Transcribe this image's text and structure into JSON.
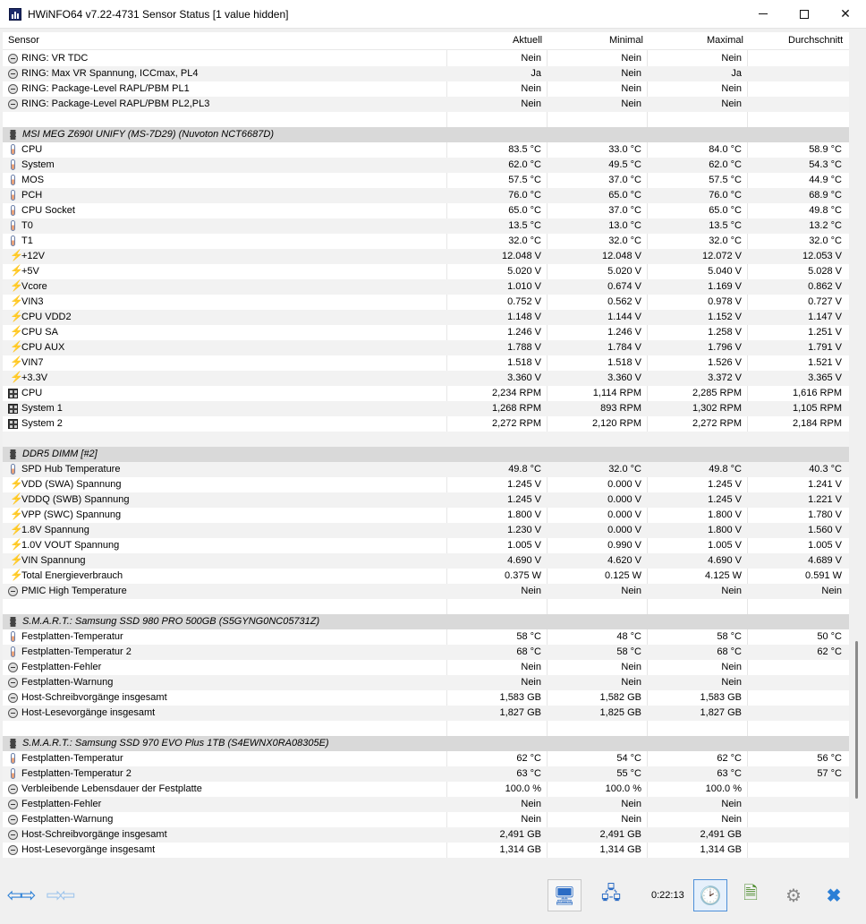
{
  "window": {
    "title": "HWiNFO64 v7.22-4731 Sensor Status [1 value hidden]"
  },
  "columns": {
    "sensor": "Sensor",
    "current": "Aktuell",
    "min": "Minimal",
    "max": "Maximal",
    "avg": "Durchschnitt"
  },
  "rows": [
    {
      "kind": "item",
      "icon": "status",
      "name": "RING: VR TDC",
      "v": [
        "Nein",
        "Nein",
        "Nein",
        ""
      ]
    },
    {
      "kind": "item",
      "icon": "status",
      "name": "RING: Max VR Spannung, ICCmax, PL4",
      "v": [
        "Ja",
        "Nein",
        "Ja",
        ""
      ]
    },
    {
      "kind": "item",
      "icon": "status",
      "name": "RING: Package-Level RAPL/PBM PL1",
      "v": [
        "Nein",
        "Nein",
        "Nein",
        ""
      ]
    },
    {
      "kind": "item",
      "icon": "status",
      "name": "RING: Package-Level RAPL/PBM PL2,PL3",
      "v": [
        "Nein",
        "Nein",
        "Nein",
        ""
      ]
    },
    {
      "kind": "blank"
    },
    {
      "kind": "group",
      "icon": "chip",
      "name": "MSI MEG Z690I UNIFY (MS-7D29) (Nuvoton NCT6687D)"
    },
    {
      "kind": "item",
      "icon": "thermo",
      "name": "CPU",
      "v": [
        "83.5 °C",
        "33.0 °C",
        "84.0 °C",
        "58.9 °C"
      ]
    },
    {
      "kind": "item",
      "icon": "thermo",
      "name": "System",
      "v": [
        "62.0 °C",
        "49.5 °C",
        "62.0 °C",
        "54.3 °C"
      ]
    },
    {
      "kind": "item",
      "icon": "thermo",
      "name": "MOS",
      "v": [
        "57.5 °C",
        "37.0 °C",
        "57.5 °C",
        "44.9 °C"
      ]
    },
    {
      "kind": "item",
      "icon": "thermo",
      "name": "PCH",
      "v": [
        "76.0 °C",
        "65.0 °C",
        "76.0 °C",
        "68.9 °C"
      ]
    },
    {
      "kind": "item",
      "icon": "thermo",
      "name": "CPU Socket",
      "v": [
        "65.0 °C",
        "37.0 °C",
        "65.0 °C",
        "49.8 °C"
      ]
    },
    {
      "kind": "item",
      "icon": "thermo",
      "name": "T0",
      "v": [
        "13.5 °C",
        "13.0 °C",
        "13.5 °C",
        "13.2 °C"
      ]
    },
    {
      "kind": "item",
      "icon": "thermo",
      "name": "T1",
      "v": [
        "32.0 °C",
        "32.0 °C",
        "32.0 °C",
        "32.0 °C"
      ]
    },
    {
      "kind": "item",
      "icon": "volt",
      "name": "+12V",
      "v": [
        "12.048 V",
        "12.048 V",
        "12.072 V",
        "12.053 V"
      ]
    },
    {
      "kind": "item",
      "icon": "volt",
      "name": "+5V",
      "v": [
        "5.020 V",
        "5.020 V",
        "5.040 V",
        "5.028 V"
      ]
    },
    {
      "kind": "item",
      "icon": "volt",
      "name": "Vcore",
      "v": [
        "1.010 V",
        "0.674 V",
        "1.169 V",
        "0.862 V"
      ]
    },
    {
      "kind": "item",
      "icon": "volt",
      "name": "VIN3",
      "v": [
        "0.752 V",
        "0.562 V",
        "0.978 V",
        "0.727 V"
      ]
    },
    {
      "kind": "item",
      "icon": "volt",
      "name": "CPU VDD2",
      "v": [
        "1.148 V",
        "1.144 V",
        "1.152 V",
        "1.147 V"
      ]
    },
    {
      "kind": "item",
      "icon": "volt",
      "name": "CPU SA",
      "v": [
        "1.246 V",
        "1.246 V",
        "1.258 V",
        "1.251 V"
      ]
    },
    {
      "kind": "item",
      "icon": "volt",
      "name": "CPU AUX",
      "v": [
        "1.788 V",
        "1.784 V",
        "1.796 V",
        "1.791 V"
      ]
    },
    {
      "kind": "item",
      "icon": "volt",
      "name": "VIN7",
      "v": [
        "1.518 V",
        "1.518 V",
        "1.526 V",
        "1.521 V"
      ]
    },
    {
      "kind": "item",
      "icon": "volt",
      "name": "+3.3V",
      "v": [
        "3.360 V",
        "3.360 V",
        "3.372 V",
        "3.365 V"
      ]
    },
    {
      "kind": "item",
      "icon": "fan",
      "name": "CPU",
      "v": [
        "2,234 RPM",
        "1,114 RPM",
        "2,285 RPM",
        "1,616 RPM"
      ]
    },
    {
      "kind": "item",
      "icon": "fan",
      "name": "System 1",
      "v": [
        "1,268 RPM",
        "893 RPM",
        "1,302 RPM",
        "1,105 RPM"
      ]
    },
    {
      "kind": "item",
      "icon": "fan",
      "name": "System 2",
      "v": [
        "2,272 RPM",
        "2,120 RPM",
        "2,272 RPM",
        "2,184 RPM"
      ]
    },
    {
      "kind": "blank"
    },
    {
      "kind": "group",
      "icon": "chip",
      "name": "DDR5 DIMM [#2]"
    },
    {
      "kind": "item",
      "icon": "thermo",
      "name": "SPD Hub Temperature",
      "v": [
        "49.8 °C",
        "32.0 °C",
        "49.8 °C",
        "40.3 °C"
      ]
    },
    {
      "kind": "item",
      "icon": "volt",
      "name": "VDD (SWA) Spannung",
      "v": [
        "1.245 V",
        "0.000 V",
        "1.245 V",
        "1.241 V"
      ]
    },
    {
      "kind": "item",
      "icon": "volt",
      "name": "VDDQ (SWB) Spannung",
      "v": [
        "1.245 V",
        "0.000 V",
        "1.245 V",
        "1.221 V"
      ]
    },
    {
      "kind": "item",
      "icon": "volt",
      "name": "VPP (SWC) Spannung",
      "v": [
        "1.800 V",
        "0.000 V",
        "1.800 V",
        "1.780 V"
      ]
    },
    {
      "kind": "item",
      "icon": "volt",
      "name": "1.8V Spannung",
      "v": [
        "1.230 V",
        "0.000 V",
        "1.800 V",
        "1.560 V"
      ]
    },
    {
      "kind": "item",
      "icon": "volt",
      "name": "1.0V VOUT Spannung",
      "v": [
        "1.005 V",
        "0.990 V",
        "1.005 V",
        "1.005 V"
      ]
    },
    {
      "kind": "item",
      "icon": "volt",
      "name": "VIN Spannung",
      "v": [
        "4.690 V",
        "4.620 V",
        "4.690 V",
        "4.689 V"
      ]
    },
    {
      "kind": "item",
      "icon": "volt",
      "name": "Total Energieverbrauch",
      "v": [
        "0.375 W",
        "0.125 W",
        "4.125 W",
        "0.591 W"
      ]
    },
    {
      "kind": "item",
      "icon": "status",
      "name": "PMIC High Temperature",
      "v": [
        "Nein",
        "Nein",
        "Nein",
        "Nein"
      ]
    },
    {
      "kind": "blank"
    },
    {
      "kind": "group",
      "icon": "chip",
      "name": "S.M.A.R.T.: Samsung SSD 980 PRO 500GB (S5GYNG0NC05731Z)"
    },
    {
      "kind": "item",
      "icon": "thermo",
      "name": "Festplatten-Temperatur",
      "v": [
        "58 °C",
        "48 °C",
        "58 °C",
        "50 °C"
      ]
    },
    {
      "kind": "item",
      "icon": "thermo",
      "name": "Festplatten-Temperatur 2",
      "v": [
        "68 °C",
        "58 °C",
        "68 °C",
        "62 °C"
      ]
    },
    {
      "kind": "item",
      "icon": "status",
      "name": "Festplatten-Fehler",
      "v": [
        "Nein",
        "Nein",
        "Nein",
        ""
      ]
    },
    {
      "kind": "item",
      "icon": "status",
      "name": "Festplatten-Warnung",
      "v": [
        "Nein",
        "Nein",
        "Nein",
        ""
      ]
    },
    {
      "kind": "item",
      "icon": "status",
      "name": "Host-Schreibvorgänge insgesamt",
      "v": [
        "1,583 GB",
        "1,582 GB",
        "1,583 GB",
        ""
      ]
    },
    {
      "kind": "item",
      "icon": "status",
      "name": "Host-Lesevorgänge insgesamt",
      "v": [
        "1,827 GB",
        "1,825 GB",
        "1,827 GB",
        ""
      ]
    },
    {
      "kind": "blank"
    },
    {
      "kind": "group",
      "icon": "chip",
      "name": "S.M.A.R.T.: Samsung SSD 970 EVO Plus 1TB (S4EWNX0RA08305E)"
    },
    {
      "kind": "item",
      "icon": "thermo",
      "name": "Festplatten-Temperatur",
      "v": [
        "62 °C",
        "54 °C",
        "62 °C",
        "56 °C"
      ]
    },
    {
      "kind": "item",
      "icon": "thermo",
      "name": "Festplatten-Temperatur 2",
      "v": [
        "63 °C",
        "55 °C",
        "63 °C",
        "57 °C"
      ]
    },
    {
      "kind": "item",
      "icon": "status",
      "name": "Verbleibende Lebensdauer der Festplatte",
      "v": [
        "100.0 %",
        "100.0 %",
        "100.0 %",
        ""
      ]
    },
    {
      "kind": "item",
      "icon": "status",
      "name": "Festplatten-Fehler",
      "v": [
        "Nein",
        "Nein",
        "Nein",
        ""
      ]
    },
    {
      "kind": "item",
      "icon": "status",
      "name": "Festplatten-Warnung",
      "v": [
        "Nein",
        "Nein",
        "Nein",
        ""
      ]
    },
    {
      "kind": "item",
      "icon": "status",
      "name": "Host-Schreibvorgänge insgesamt",
      "v": [
        "2,491 GB",
        "2,491 GB",
        "2,491 GB",
        ""
      ]
    },
    {
      "kind": "item",
      "icon": "status",
      "name": "Host-Lesevorgänge insgesamt",
      "v": [
        "1,314 GB",
        "1,314 GB",
        "1,314 GB",
        ""
      ]
    }
  ],
  "toolbar": {
    "timer": "0:22:13"
  },
  "colors": {
    "group_bg": "#d9d9d9",
    "alt_row_bg": "#f2f2f2",
    "accent_blue": "#2b7fd6",
    "volt_yellow": "#e8b800"
  }
}
